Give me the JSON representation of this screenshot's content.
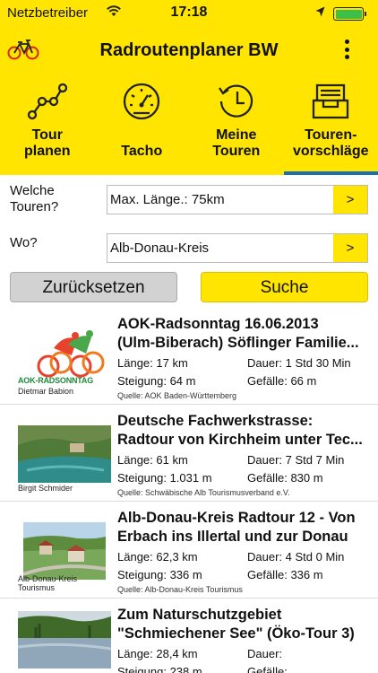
{
  "status_bar": {
    "carrier": "Netzbetreiber",
    "time": "17:18",
    "battery_level": 1.0
  },
  "header": {
    "title": "Radroutenplaner BW"
  },
  "tabs": [
    {
      "label": "Tour\nplanen",
      "icon": "route-icon",
      "active": false
    },
    {
      "label": "Tacho",
      "icon": "speedometer-icon",
      "active": false
    },
    {
      "label": "Meine\nTouren",
      "icon": "history-icon",
      "active": false
    },
    {
      "label": "Touren-\nvorschläge",
      "icon": "inbox-icon",
      "active": true
    }
  ],
  "filters": {
    "which_label": "Welche\nTouren?",
    "which_value": "Max. Länge.: 75km",
    "where_label": "Wo?",
    "where_value": "Alb-Donau-Kreis",
    "go_label": ">"
  },
  "buttons": {
    "reset": "Zurücksetzen",
    "search": "Suche"
  },
  "labels": {
    "length": "Länge:",
    "duration": "Dauer:",
    "climb": "Steigung:",
    "descent": "Gefälle:"
  },
  "tours": [
    {
      "title_1": "AOK-Radsonntag 16.06.2013",
      "title_2": "(Ulm-Biberach) Söflinger Familie...",
      "length": "17 km",
      "duration": "1 Std 30 Min",
      "climb": "64 m",
      "descent": "66 m",
      "source": "Quelle: AOK Baden-Württemberg",
      "credit": "Dietmar Babion",
      "logo_text": "AOK-RADSONNTAG"
    },
    {
      "title_1": "Deutsche Fachwerkstrasse:",
      "title_2": "Radtour von Kirchheim unter Tec...",
      "length": "61 km",
      "duration": "7 Std 7 Min",
      "climb": "1.031 m",
      "descent": "830 m",
      "source": "Quelle: Schwäbische Alb Tourismusverband e.V.",
      "credit": "Birgit Schmider"
    },
    {
      "title_1": "Alb-Donau-Kreis Radtour 12 - Von",
      "title_2": "Erbach ins Illertal und zur Donau",
      "length": "62,3 km",
      "duration": "4 Std 0 Min",
      "climb": "336 m",
      "descent": "336 m",
      "source": "Quelle: Alb-Donau-Kreis Tourismus",
      "credit": "Alb-Donau-Kreis\nTourismus"
    },
    {
      "title_1": "Zum Naturschutzgebiet",
      "title_2": "\"Schmiechener See\" (Öko-Tour 3)",
      "length": "28,4 km",
      "duration": "",
      "climb": "238 m",
      "descent": "",
      "source": "",
      "credit": ""
    }
  ],
  "colors": {
    "brand_yellow": "#ffe500",
    "active_tab": "#1a6fb0"
  }
}
